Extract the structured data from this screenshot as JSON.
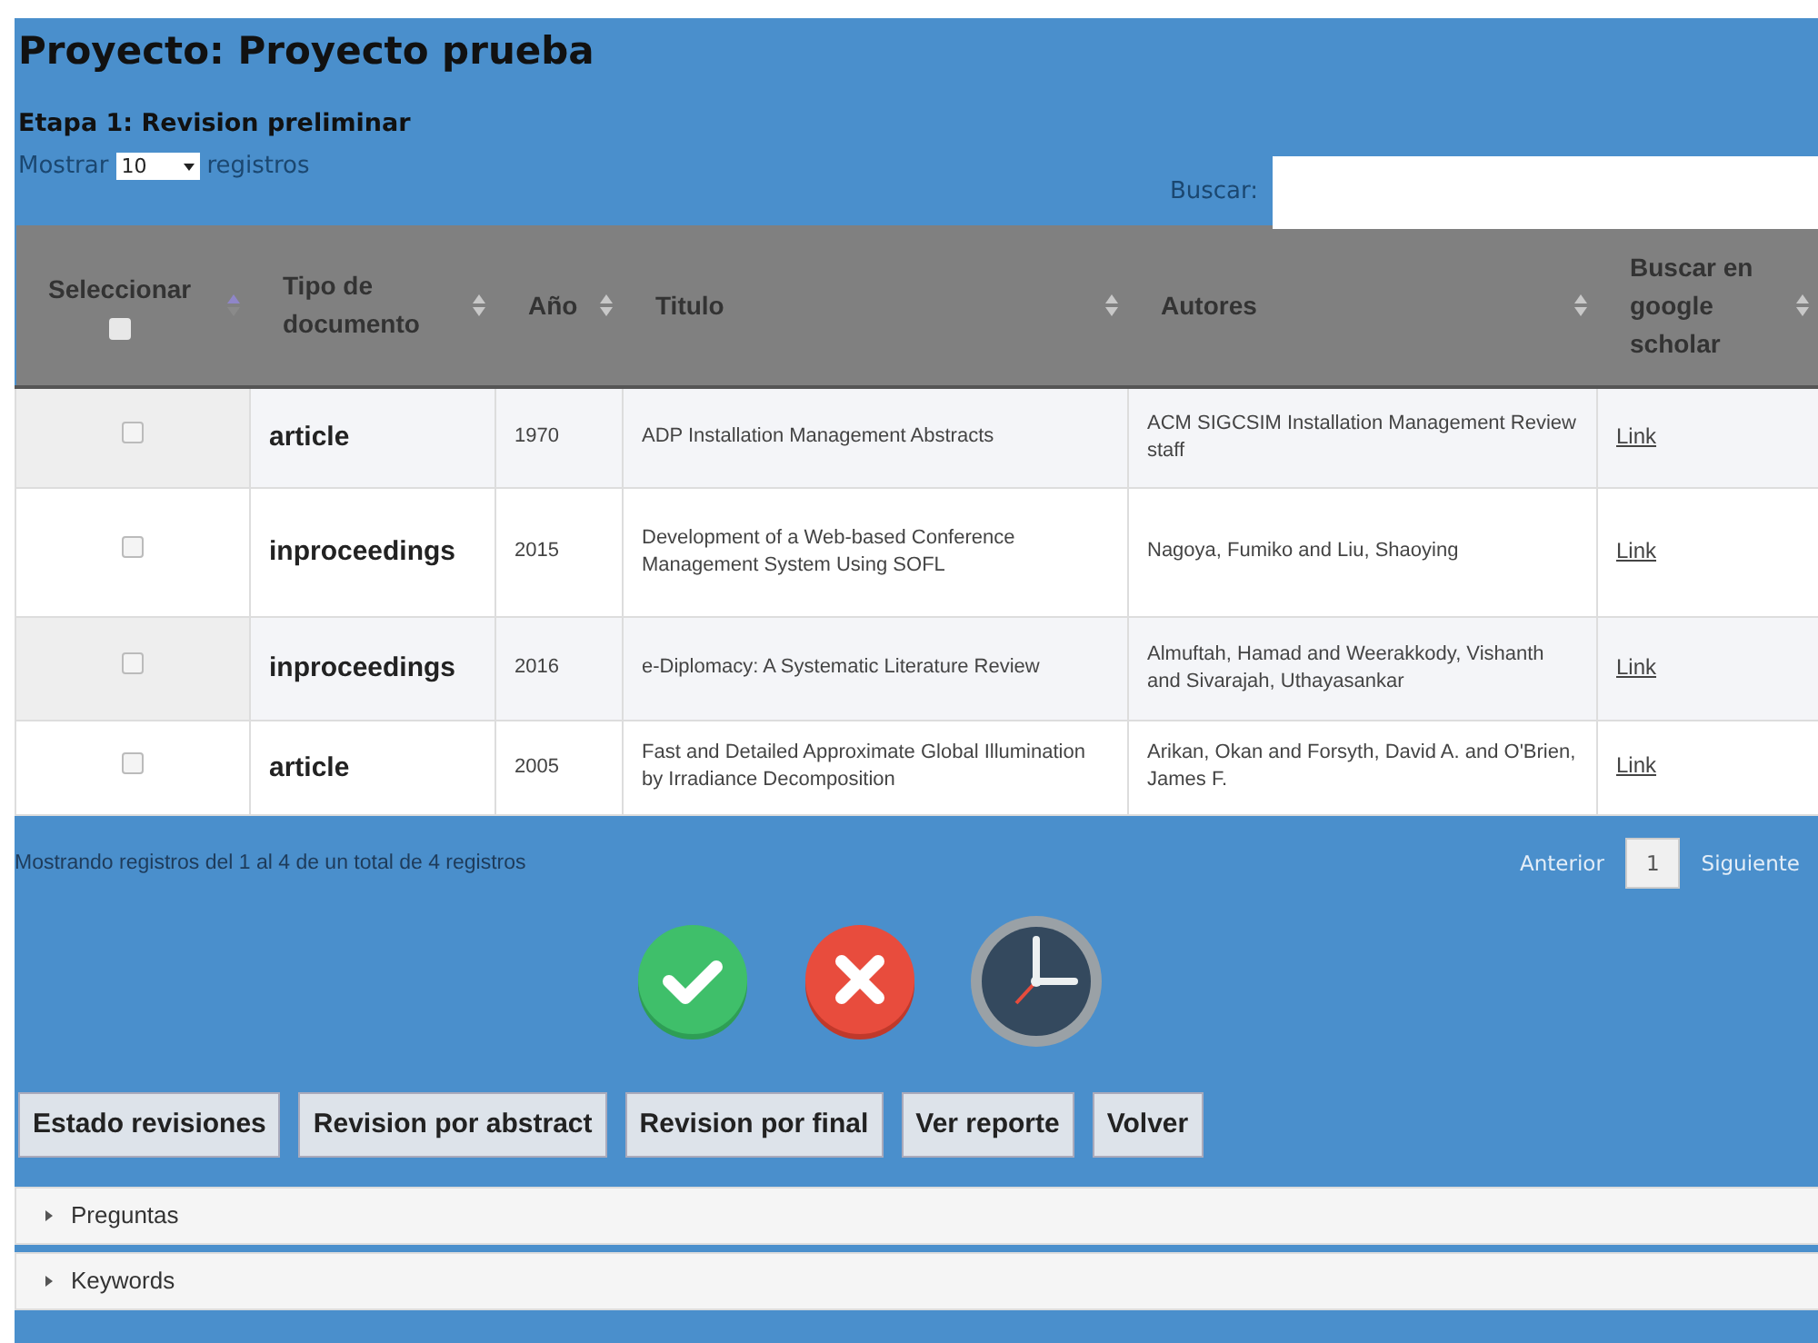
{
  "title": "Proyecto: Proyecto prueba",
  "stage": "Etapa 1: Revision preliminar",
  "length": {
    "before": "Mostrar",
    "value": "10",
    "after": "registros"
  },
  "search": {
    "label": "Buscar:"
  },
  "table": {
    "columns": [
      {
        "label": "Seleccionar",
        "kind": "checkbox",
        "sorted": true,
        "checked": false
      },
      {
        "label": "Tipo de documento",
        "kind": "text",
        "sorted": false
      },
      {
        "label": "Año",
        "kind": "text",
        "sorted": false
      },
      {
        "label": "Titulo",
        "kind": "text",
        "sorted": false
      },
      {
        "label": "Autores",
        "kind": "text",
        "sorted": false
      },
      {
        "label": "Buscar en google scholar",
        "kind": "text",
        "sorted": false
      }
    ],
    "rows": [
      {
        "checked": false,
        "type": "article",
        "year": "1970",
        "title": "ADP Installation Management Abstracts",
        "authors": "ACM SIGCSIM Installation Management Review staff",
        "link": "Link"
      },
      {
        "checked": false,
        "type": "inproceedings",
        "year": "2015",
        "title": "Development of a Web-based Conference Management System Using SOFL",
        "authors": "Nagoya, Fumiko and Liu, Shaoying",
        "link": "Link"
      },
      {
        "checked": false,
        "type": "inproceedings",
        "year": "2016",
        "title": "e-Diplomacy: A Systematic Literature Review",
        "authors": "Almuftah, Hamad and Weerakkody, Vishanth and Sivarajah, Uthayasankar",
        "link": "Link"
      },
      {
        "checked": false,
        "type": "article",
        "year": "2005",
        "title": "Fast and Detailed Approximate Global Illumination by Irradiance Decomposition",
        "authors": "Arikan, Okan and Forsyth, David A. and O'Brien, James F.",
        "link": "Link"
      }
    ]
  },
  "info": "Mostrando registros del 1 al 4 de un total de 4 registros",
  "pagination": [
    {
      "label": "Anterior",
      "disabled": true,
      "selected": false
    },
    {
      "label": "1",
      "disabled": false,
      "selected": true
    },
    {
      "label": "Siguiente",
      "disabled": true,
      "selected": false
    }
  ],
  "actions": [
    {
      "kind": "accept"
    },
    {
      "kind": "reject"
    },
    {
      "kind": "pending"
    }
  ],
  "buttons": [
    "Estado revisiones",
    "Revision por abstract",
    "Revision por final",
    "Ver reporte",
    "Volver"
  ],
  "panels": [
    {
      "label": "Preguntas",
      "expanded": false
    },
    {
      "label": "Keywords",
      "expanded": false
    }
  ]
}
